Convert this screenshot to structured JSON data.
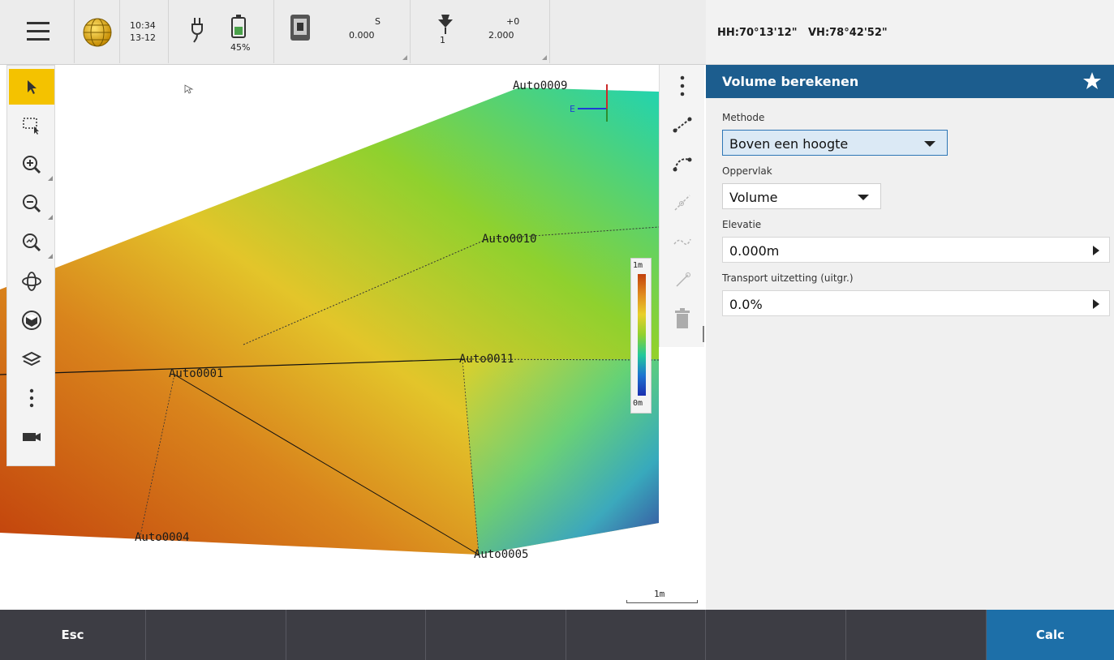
{
  "statusbar": {
    "time": "10:34",
    "date": "13-12",
    "battery": "45%",
    "s_label": "S",
    "s_value": "0.000",
    "target_count": "1",
    "offset_label": "+0",
    "offset_value": "2.000"
  },
  "angles": {
    "hh": "HH:70°13'12\"",
    "vh": "VH:78°42'52\""
  },
  "map": {
    "points": [
      "Auto0009",
      "Auto0010",
      "Auto0001",
      "Auto0011",
      "Auto0004",
      "Auto0005"
    ],
    "legend_top": "1m",
    "legend_bottom": "0m",
    "scale_label": "1m",
    "north_label": "E",
    "legend_colors": [
      "#c2410c",
      "#e08a1e",
      "#e8d02a",
      "#8fd12e",
      "#22c99a",
      "#1c74d1",
      "#1b2fb0"
    ]
  },
  "left_toolbar": {
    "icons": [
      "select-arrow-icon",
      "select-rectangle-icon",
      "zoom-in-icon",
      "zoom-out-icon",
      "zoom-extents-icon",
      "orbit-icon",
      "cube-view-icon",
      "layers-icon",
      "more-icon",
      "camera-icon"
    ]
  },
  "right_toolbar": {
    "icons": [
      "more-vertical-icon",
      "line-icon",
      "arc-icon",
      "polyline-icon",
      "curve-icon",
      "point-pencil-icon",
      "trash-icon"
    ]
  },
  "panel": {
    "title": "Volume berekenen",
    "methode_label": "Methode",
    "methode_value": "Boven een hoogte",
    "oppervlak_label": "Oppervlak",
    "oppervlak_value": "Volume",
    "elevatie_label": "Elevatie",
    "elevatie_value": "0.000m",
    "transport_label": "Transport uitzetting (uitgr.)",
    "transport_value": "0.0%"
  },
  "bottombar": {
    "esc": "Esc",
    "calc": "Calc"
  },
  "colors": {
    "accent": "#1c5d8e",
    "active_tool": "#f4c200",
    "bottom_bar": "#3d3d44",
    "calc_button": "#1d6fa8"
  }
}
